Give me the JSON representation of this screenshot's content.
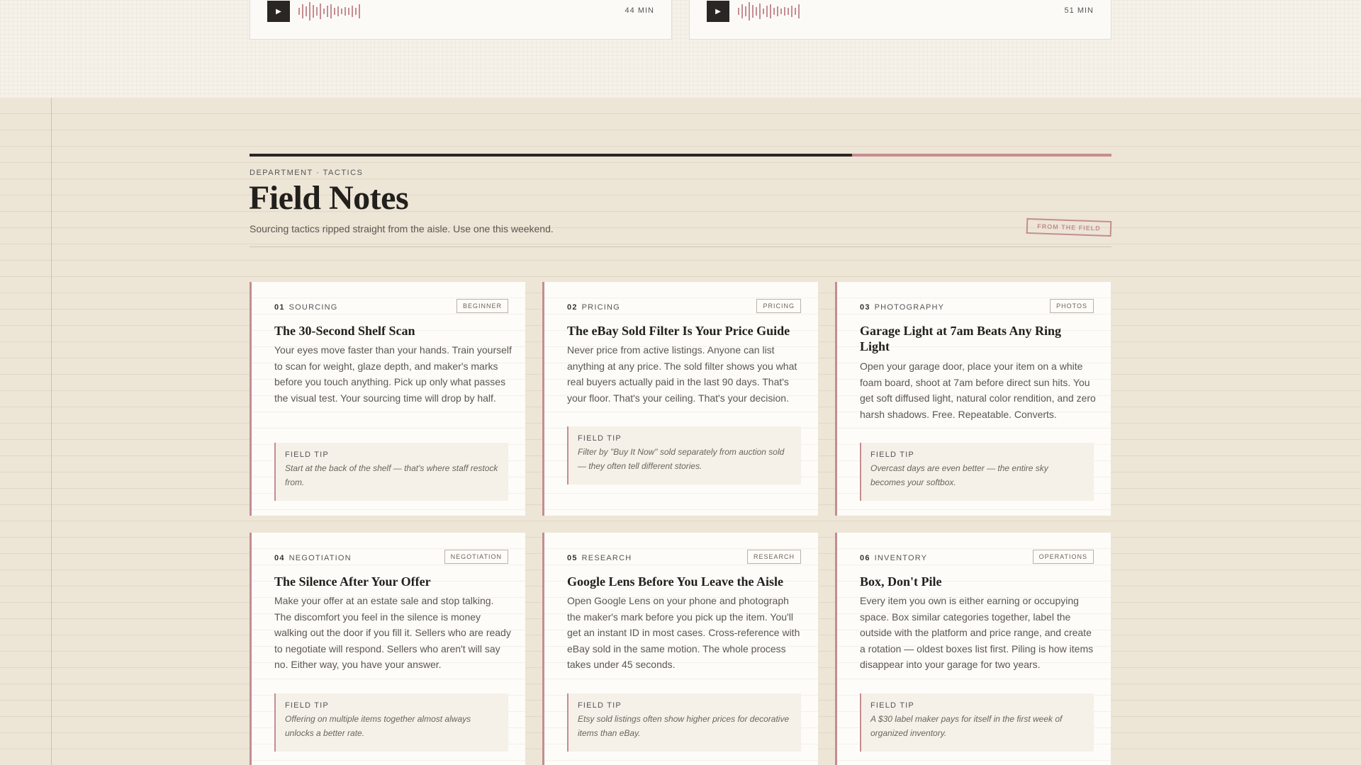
{
  "episodes": [
    {
      "duration": "44 MIN"
    },
    {
      "duration": "51 MIN"
    }
  ],
  "section": {
    "eyebrow": "DEPARTMENT · TACTICS",
    "title": "Field Notes",
    "subtitle": "Sourcing tactics ripped straight from the aisle. Use one this weekend.",
    "stamp": "FROM THE FIELD"
  },
  "cards": [
    {
      "num": "01",
      "category": "SOURCING",
      "tag": "BEGINNER",
      "title": "The 30-Second Shelf Scan",
      "body": "Your eyes move faster than your hands. Train yourself to scan for weight, glaze depth, and maker's marks before you touch anything. Pick up only what passes the visual test. Your sourcing time will drop by half.",
      "tip_label": "FIELD TIP",
      "tip": "Start at the back of the shelf — that's where staff restock from."
    },
    {
      "num": "02",
      "category": "PRICING",
      "tag": "PRICING",
      "title": "The eBay Sold Filter Is Your Price Guide",
      "body": "Never price from active listings. Anyone can list anything at any price. The sold filter shows you what real buyers actually paid in the last 90 days. That's your floor. That's your ceiling. That's your decision.",
      "tip_label": "FIELD TIP",
      "tip": "Filter by \"Buy It Now\" sold separately from auction sold — they often tell different stories."
    },
    {
      "num": "03",
      "category": "PHOTOGRAPHY",
      "tag": "PHOTOS",
      "title": "Garage Light at 7am Beats Any Ring Light",
      "body": "Open your garage door, place your item on a white foam board, shoot at 7am before direct sun hits. You get soft diffused light, natural color rendition, and zero harsh shadows. Free. Repeatable. Converts.",
      "tip_label": "FIELD TIP",
      "tip": "Overcast days are even better — the entire sky becomes your softbox."
    },
    {
      "num": "04",
      "category": "NEGOTIATION",
      "tag": "NEGOTIATION",
      "title": "The Silence After Your Offer",
      "body": "Make your offer at an estate sale and stop talking. The discomfort you feel in the silence is money walking out the door if you fill it. Sellers who are ready to negotiate will respond. Sellers who aren't will say no. Either way, you have your answer.",
      "tip_label": "FIELD TIP",
      "tip": "Offering on multiple items together almost always unlocks a better rate."
    },
    {
      "num": "05",
      "category": "RESEARCH",
      "tag": "RESEARCH",
      "title": "Google Lens Before You Leave the Aisle",
      "body": "Open Google Lens on your phone and photograph the maker's mark before you pick up the item. You'll get an instant ID in most cases. Cross-reference with eBay sold in the same motion. The whole process takes under 45 seconds.",
      "tip_label": "FIELD TIP",
      "tip": "Etsy sold listings often show higher prices for decorative items than eBay."
    },
    {
      "num": "06",
      "category": "INVENTORY",
      "tag": "OPERATIONS",
      "title": "Box, Don't Pile",
      "body": "Every item you own is either earning or occupying space. Box similar categories together, label the outside with the platform and price range, and create a rotation — oldest boxes list first. Piling is how items disappear into your garage for two years.",
      "tip_label": "FIELD TIP",
      "tip": "A $30 label maker pays for itself in the first week of organized inventory."
    }
  ]
}
